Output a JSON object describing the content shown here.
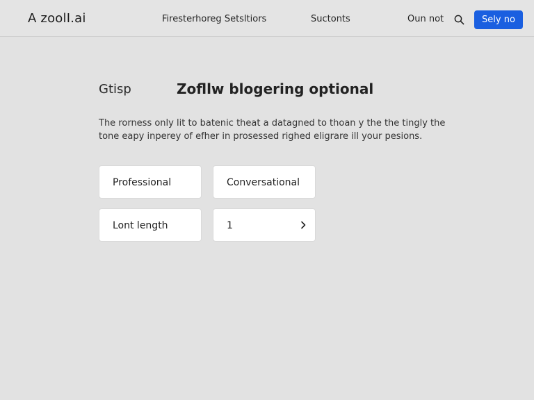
{
  "header": {
    "logo": "A zoolI.ai",
    "nav": [
      "Firesterhoreg Setsltiors",
      "Suctonts",
      "Oun not"
    ],
    "cta_label": "Sely no",
    "search_icon": "search-icon"
  },
  "main": {
    "section_label": "Gtisp",
    "title": "Zofllw blogering optional",
    "description": "The rorness only lit to batenic theat a datagned to thoan y the the tingly the tone eapy inperey of efher in prosessed righed eligrare ill your pesions.",
    "options": [
      {
        "label": "Professional"
      },
      {
        "label": "Conversational"
      },
      {
        "label": "Lont length"
      },
      {
        "label": "1"
      }
    ]
  },
  "colors": {
    "background": "#e2e2e2",
    "accent": "#1a5fe0",
    "card": "#ffffff"
  }
}
